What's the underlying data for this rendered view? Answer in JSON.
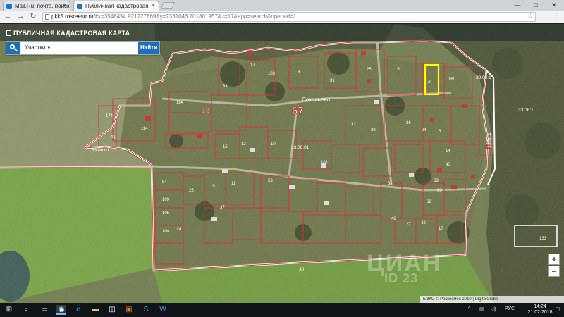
{
  "browser": {
    "tabs": [
      {
        "title": "Mail.Ru: почта, поиск в",
        "favicon_color": "#1677d2",
        "active": false
      },
      {
        "title": "Публичная кадастровая",
        "favicon_color": "#2a6ebb",
        "active": true
      }
    ],
    "url_host": "pkk5.rosreestr.ru/",
    "url_rest": "#x=3548454.921227869&y=7331046.701801957&z=17&app=search&opened=1",
    "window_controls": [
      "—",
      "□",
      "✕"
    ]
  },
  "map_app": {
    "title": "ПУБЛИЧНАЯ КАДАСТРОВАЯ КАРТА",
    "search": {
      "type_selected": "Участки",
      "input_value": "",
      "button_label": "Найти"
    },
    "zoom": {
      "in": "+",
      "out": "−"
    },
    "attribution": "ЕЭКО © Роскосмос 2010 | DigitalGlobe",
    "watermark": {
      "brand": "ЦИАН",
      "id": "ID 23"
    },
    "colors": {
      "parcel_border": "#d6323c",
      "boundary": "#ffffff",
      "selected": "#ffff00"
    }
  },
  "map_labels": [
    {
      "text": "67",
      "size": "big"
    },
    {
      "text": "Сокольево",
      "size": "small"
    },
    {
      "text": "33:06:01",
      "size": "small"
    },
    {
      "text": "33:06:01",
      "size": "small"
    },
    {
      "text": "33:06:1",
      "size": "small"
    },
    {
      "text": "33:06:1",
      "size": "small"
    },
    {
      "text": "33:06:1",
      "size": "small"
    },
    {
      "text": "13",
      "size": "mid"
    },
    {
      "text": "30",
      "size": "small"
    },
    {
      "text": "2",
      "size": "small"
    },
    {
      "text": "160",
      "size": "small"
    },
    {
      "text": "83",
      "size": "small"
    },
    {
      "text": "8",
      "size": "small"
    },
    {
      "text": "17",
      "size": "small"
    },
    {
      "text": "31",
      "size": "small"
    },
    {
      "text": "25",
      "size": "small"
    },
    {
      "text": "15",
      "size": "small"
    },
    {
      "text": "103",
      "size": "small"
    },
    {
      "text": "184",
      "size": "small"
    },
    {
      "text": "114",
      "size": "small"
    },
    {
      "text": "41",
      "size": "small"
    },
    {
      "text": "174",
      "size": "small"
    },
    {
      "text": "15",
      "size": "small"
    },
    {
      "text": "32",
      "size": "small"
    },
    {
      "text": "24",
      "size": "small"
    },
    {
      "text": "36",
      "size": "small"
    },
    {
      "text": "14",
      "size": "small"
    },
    {
      "text": "28",
      "size": "small"
    },
    {
      "text": "101",
      "size": "small"
    },
    {
      "text": "12",
      "size": "small"
    },
    {
      "text": "10",
      "size": "small"
    },
    {
      "text": "84",
      "size": "small"
    },
    {
      "text": "109",
      "size": "small"
    },
    {
      "text": "105",
      "size": "small"
    },
    {
      "text": "100",
      "size": "small"
    },
    {
      "text": "25",
      "size": "small"
    },
    {
      "text": "19",
      "size": "small"
    },
    {
      "text": "11",
      "size": "small"
    },
    {
      "text": "37",
      "size": "small"
    },
    {
      "text": "53",
      "size": "small"
    },
    {
      "text": "34",
      "size": "small"
    },
    {
      "text": "62",
      "size": "small"
    },
    {
      "text": "63",
      "size": "small"
    },
    {
      "text": "6",
      "size": "small"
    },
    {
      "text": "60",
      "size": "small"
    },
    {
      "text": "48",
      "size": "small"
    },
    {
      "text": "40",
      "size": "small"
    },
    {
      "text": "42",
      "size": "small"
    },
    {
      "text": "27",
      "size": "small"
    },
    {
      "text": "17",
      "size": "small"
    },
    {
      "text": "101",
      "size": "small"
    },
    {
      "text": "133",
      "size": "small"
    }
  ],
  "taskbar": {
    "time": "14:24",
    "date": "21.02.2018",
    "lang": "РУС"
  }
}
